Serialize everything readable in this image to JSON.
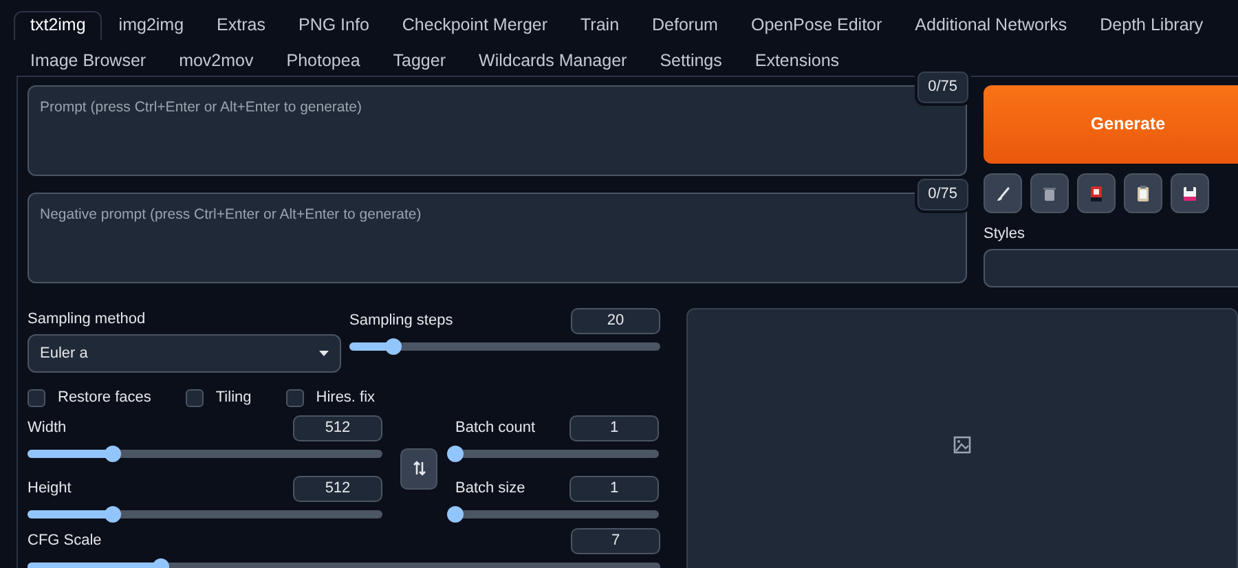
{
  "tabs": [
    {
      "label": "txt2img",
      "selected": true
    },
    {
      "label": "img2img",
      "selected": false
    },
    {
      "label": "Extras",
      "selected": false
    },
    {
      "label": "PNG Info",
      "selected": false
    },
    {
      "label": "Checkpoint Merger",
      "selected": false
    },
    {
      "label": "Train",
      "selected": false
    },
    {
      "label": "Deforum",
      "selected": false
    },
    {
      "label": "OpenPose Editor",
      "selected": false
    },
    {
      "label": "Additional Networks",
      "selected": false
    },
    {
      "label": "Depth Library",
      "selected": false
    },
    {
      "label": "Image Browser",
      "selected": false
    },
    {
      "label": "mov2mov",
      "selected": false
    },
    {
      "label": "Photopea",
      "selected": false
    },
    {
      "label": "Tagger",
      "selected": false
    },
    {
      "label": "Wildcards Manager",
      "selected": false
    },
    {
      "label": "Settings",
      "selected": false
    },
    {
      "label": "Extensions",
      "selected": false
    }
  ],
  "prompts": [
    {
      "placeholder": "Prompt (press Ctrl+Enter or Alt+Enter to generate)",
      "token_count": "0/75"
    },
    {
      "placeholder": "Negative prompt (press Ctrl+Enter or Alt+Enter to generate)",
      "token_count": "0/75"
    }
  ],
  "generate_button": "Generate",
  "styles": {
    "label": "Styles"
  },
  "sampling_method": {
    "label": "Sampling method",
    "value": "Euler a"
  },
  "sampling_steps": {
    "label": "Sampling steps",
    "value": "20",
    "level": 0.14
  },
  "checkboxes": [
    {
      "label": "Restore faces",
      "checked": false
    },
    {
      "label": "Tiling",
      "checked": false
    },
    {
      "label": "Hires. fix",
      "checked": false
    }
  ],
  "width": {
    "label": "Width",
    "value": "512",
    "level": 0.24
  },
  "height": {
    "label": "Height",
    "value": "512",
    "level": 0.24
  },
  "batch_count": {
    "label": "Batch count",
    "value": "1",
    "level": 0
  },
  "batch_size": {
    "label": "Batch size",
    "value": "1",
    "level": 0
  },
  "cfg_scale": {
    "label": "CFG Scale",
    "value": "7",
    "level": 0.21
  }
}
